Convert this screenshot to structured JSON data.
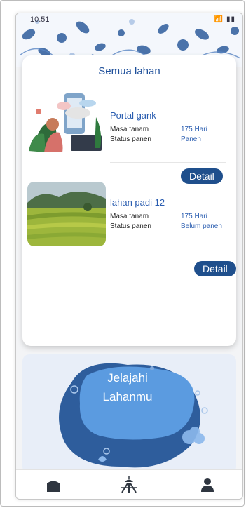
{
  "status_bar": {
    "time": "10.51",
    "icons": "📶 ▮▮"
  },
  "page": {
    "title": "Semua lahan"
  },
  "lands": [
    {
      "name": "Portal gank",
      "rows": [
        {
          "label": "Masa tanam",
          "value": "175 Hari"
        },
        {
          "label": "Status panen",
          "value": "Panen"
        }
      ],
      "button": "Detail",
      "image": "illustration-person-phone"
    },
    {
      "name": "lahan padi 12",
      "rows": [
        {
          "label": "Masa tanam",
          "value": "175 Hari"
        },
        {
          "label": "Status panen",
          "value": "Belum panen"
        }
      ],
      "button": "Detail",
      "image": "rice-field-photo"
    }
  ],
  "banner": {
    "line1": "Jelajahi",
    "line2": "Lahanmu"
  },
  "nav": [
    {
      "icon": "home-icon"
    },
    {
      "icon": "field-icon"
    },
    {
      "icon": "profile-icon"
    }
  ],
  "colors": {
    "primary": "#1f4f8c",
    "accent_text": "#2a5db0",
    "banner_blob": "#4e8fd6"
  }
}
